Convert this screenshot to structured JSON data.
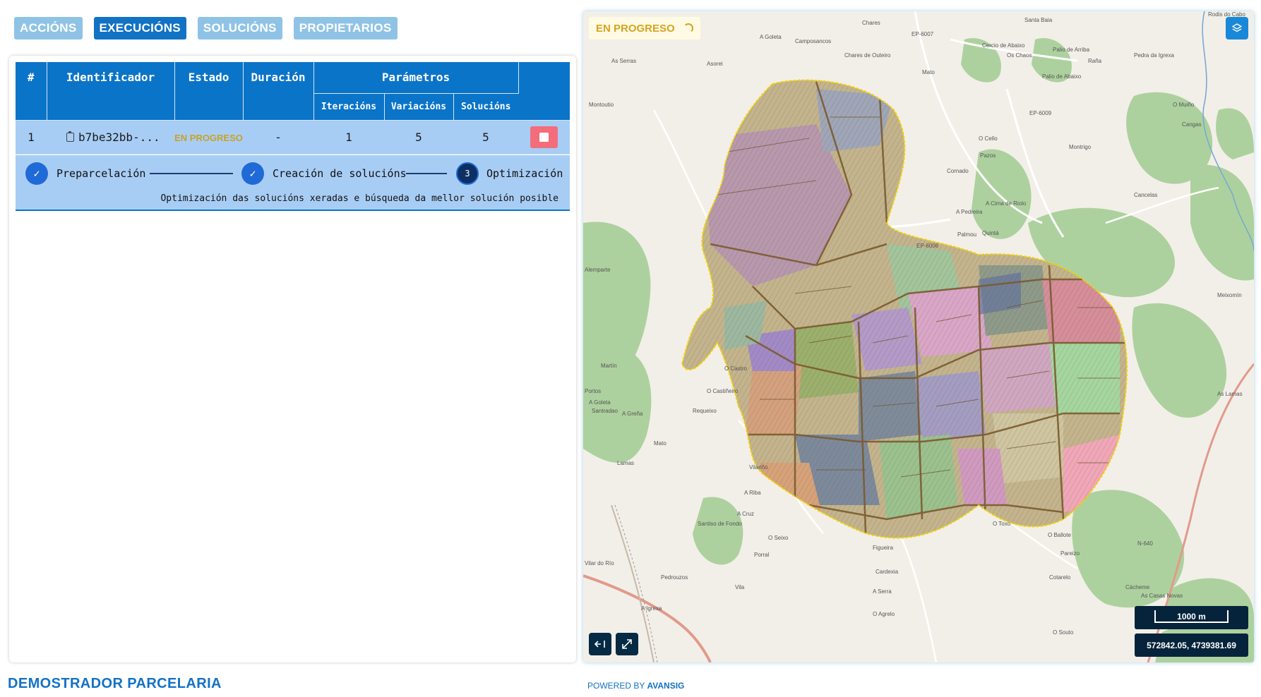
{
  "tabs": [
    {
      "label": "ACCIÓNS",
      "active": false
    },
    {
      "label": "EXECUCIÓNS",
      "active": true
    },
    {
      "label": "SOLUCIÓNS",
      "active": false
    },
    {
      "label": "PROPIETARIOS",
      "active": false
    }
  ],
  "table": {
    "headers": {
      "index": "#",
      "id": "Identificador",
      "state": "Estado",
      "duration": "Duración",
      "params": "Parámetros",
      "iterations": "Iteracións",
      "variations": "Variacións",
      "solutions": "Solucións"
    },
    "row": {
      "index": "1",
      "id": "b7be32bb-...",
      "state": "EN PROGRESO",
      "duration": "-",
      "iterations": "1",
      "variations": "5",
      "solutions": "5"
    }
  },
  "progress": {
    "steps": [
      {
        "label": "Preparcelación",
        "status": "done"
      },
      {
        "label": "Creación de solucións",
        "status": "done"
      },
      {
        "label": "Optimización",
        "status": "current",
        "number": "3"
      }
    ],
    "description": "Optimización das solucións xeradas e búsqueda da mellor solución posible"
  },
  "map": {
    "status_badge": "EN PROGRESO",
    "scale": "1000 m",
    "coordinates": "572842.05, 4739381.69",
    "colors": {
      "parcel_border": "#7a5a2e",
      "boundary": "#f1d100",
      "forest": "#a9d08e",
      "road": "#e79a8a"
    },
    "places": [
      "A Goleta",
      "Camposancos",
      "Chares",
      "Santa Baia",
      "Rodis do Cabo",
      "EP-6007",
      "Chares de Outeiro",
      "Cercio de Abaixo",
      "Os Chaos",
      "Palio de Arriba",
      "Pedra da Igrexa",
      "Raña",
      "Palio de Abaixo",
      "Asorei",
      "Mato",
      "As Serras",
      "Montoutio",
      "EP-6009",
      "O Muiño",
      "Cangas",
      "O Cello",
      "Pazos",
      "Montrigo",
      "Cornado",
      "A Cima de Riolo",
      "Cancelas",
      "A Pedreira",
      "Palmou",
      "Quintá",
      "EP-6006",
      "Meixomín",
      "As Lamas",
      "Martín",
      "O Castro",
      "O Castiñeiro",
      "Portos",
      "A Goleta",
      "Santradao",
      "A Greña",
      "Requeixo",
      "Mato",
      "Lamas",
      "Vilariño",
      "A Riba",
      "A Cruz",
      "Santiso de Fondo",
      "O Seixo",
      "Porral",
      "Figueira",
      "O Toxo",
      "O Ballote",
      "Pareizo",
      "Cardexia",
      "A Serra",
      "Cotarelo",
      "Cácheme",
      "As Casas Novas",
      "N-640",
      "Vilar do Río",
      "Pedrouzos",
      "Vila",
      "A Igrexa",
      "O Agrelo",
      "O Souto",
      "Alemparte"
    ]
  },
  "footer": {
    "brand": "DEMOSTRADOR PARCELARIA",
    "powered_prefix": "POWERED BY",
    "powered_brand": "AVANSIG"
  }
}
